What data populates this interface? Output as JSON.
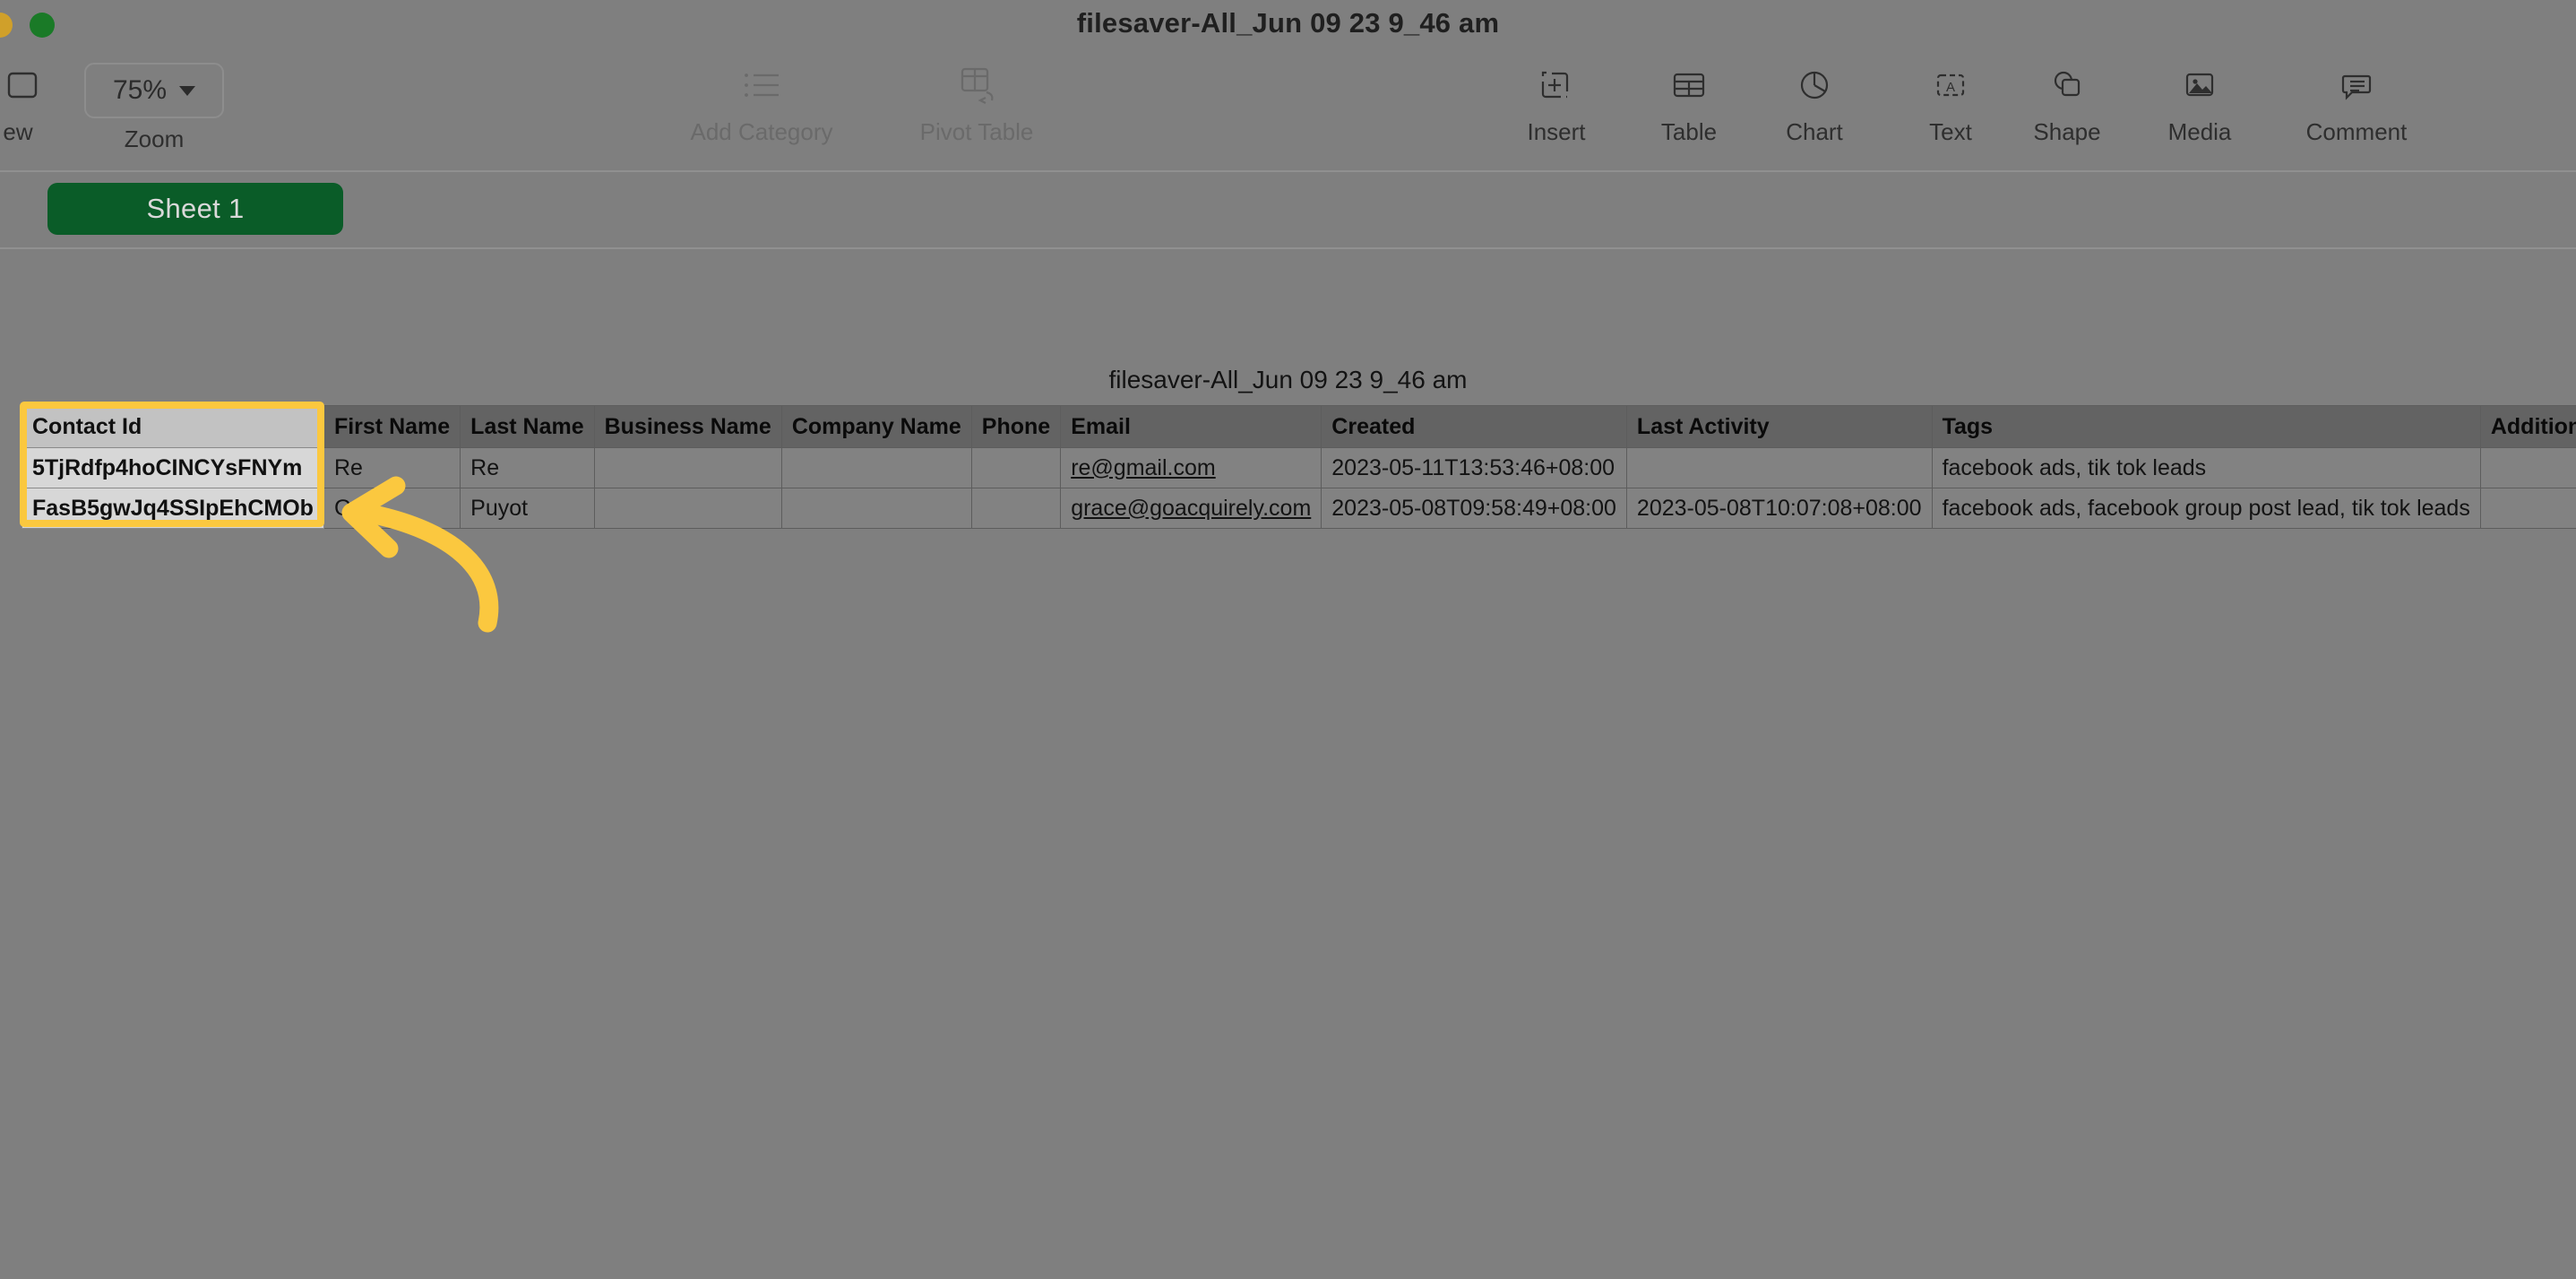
{
  "window": {
    "title": "filesaver-All_Jun 09 23 9_46 am",
    "traffic_lights": [
      "minimize",
      "maximize"
    ]
  },
  "toolbar": {
    "view": {
      "label": "ew",
      "icon": "view-panel-icon"
    },
    "zoom": {
      "label": "Zoom",
      "value": "75%",
      "icon": "chevron-down-icon"
    },
    "items": [
      {
        "label": "Add Category",
        "icon": "bulleted-list-icon",
        "disabled": true
      },
      {
        "label": "Pivot Table",
        "icon": "pivot-table-icon",
        "disabled": true
      },
      {
        "label": "Insert",
        "icon": "insert-cell-icon",
        "disabled": false
      },
      {
        "label": "Table",
        "icon": "table-grid-icon",
        "disabled": false
      },
      {
        "label": "Chart",
        "icon": "pie-chart-icon",
        "disabled": false
      },
      {
        "label": "Text",
        "icon": "text-box-icon",
        "disabled": false
      },
      {
        "label": "Shape",
        "icon": "shape-icon",
        "disabled": false
      },
      {
        "label": "Media",
        "icon": "media-image-icon",
        "disabled": false
      },
      {
        "label": "Comment",
        "icon": "comment-bubble-icon",
        "disabled": false
      }
    ]
  },
  "sheet_tabs": [
    {
      "label": "Sheet 1",
      "active": true
    }
  ],
  "table": {
    "caption": "filesaver-All_Jun 09 23 9_46 am",
    "headers": [
      "Contact Id",
      "First Name",
      "Last Name",
      "Business Name",
      "Company Name",
      "Phone",
      "Email",
      "Created",
      "Last Activity",
      "Tags",
      "Additional Emails",
      ""
    ],
    "rows": [
      {
        "contact_id": "5TjRdfp4hoCINCYsFNYm",
        "first_name": "Re",
        "last_name": "Re",
        "business_name": "",
        "company_name": "",
        "phone": "",
        "email": "re@gmail.com",
        "created": "2023-05-11T13:53:46+08:00",
        "last_activity": "",
        "tags": "facebook ads, tik tok leads",
        "additional_emails": "",
        "extra": ""
      },
      {
        "contact_id": "FasB5gwJq4SSIpEhCMOb",
        "first_name": "Gr",
        "last_name": "Puyot",
        "business_name": "",
        "company_name": "",
        "phone": "",
        "email": "grace@goacquirely.com",
        "created": "2023-05-08T09:58:49+08:00",
        "last_activity": "2023-05-08T10:07:08+08:00",
        "tags": "facebook ads, facebook group post lead, tik tok leads",
        "additional_emails": "",
        "extra": ""
      }
    ],
    "highlighted_column": "Contact Id"
  },
  "annotations": {
    "highlight_color": "#fbc83f",
    "arrow_color": "#fbc83f",
    "arrow_target": "Contact Id column"
  },
  "colors": {
    "app_background": "#7f7f7f",
    "sheet_tab_active": "#0a5c28",
    "header_cell": "#636363",
    "body_cell": "#828282",
    "highlight_cell": "#d7d7d7"
  }
}
